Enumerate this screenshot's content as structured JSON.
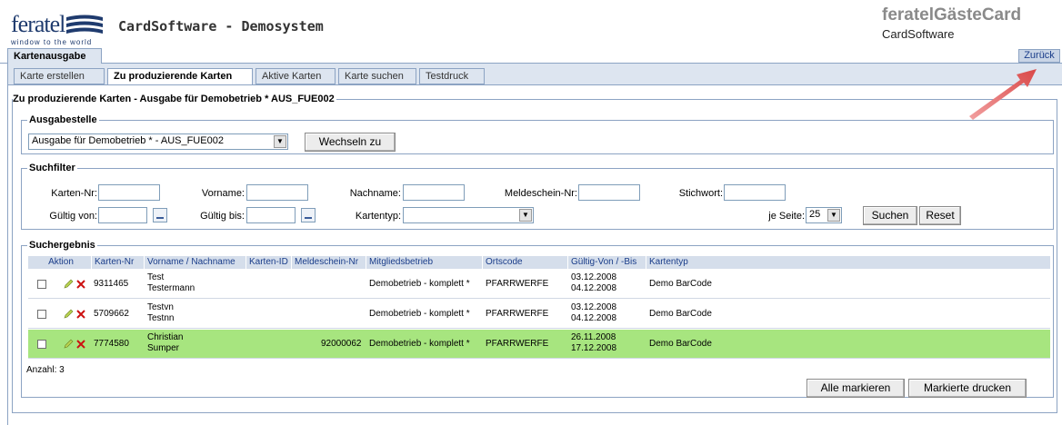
{
  "header": {
    "logo_word": "feratel",
    "logo_tagline": "window to the world",
    "app_title": "CardSoftware - Demosystem",
    "brand_title": "feratelGästeCard",
    "brand_subtitle": "CardSoftware"
  },
  "topnav": {
    "main_tab": "Kartenausgabe",
    "back_label": "Zurück"
  },
  "subtabs": [
    {
      "label": "Karte erstellen",
      "active": false
    },
    {
      "label": "Zu produzierende Karten",
      "active": true
    },
    {
      "label": "Aktive Karten",
      "active": false
    },
    {
      "label": "Karte suchen",
      "active": false
    },
    {
      "label": "Testdruck",
      "active": false
    }
  ],
  "section_title": "Zu produzierende Karten - Ausgabe für Demobetrieb * AUS_FUE002",
  "ausgabestelle": {
    "legend": "Ausgabestelle",
    "select_value": "Ausgabe für Demobetrieb * - AUS_FUE002",
    "switch_label": "Wechseln zu"
  },
  "suchfilter": {
    "legend": "Suchfilter",
    "labels": {
      "karten_nr": "Karten-Nr:",
      "vorname": "Vorname:",
      "nachname": "Nachname:",
      "meldeschein_nr": "Meldeschein-Nr:",
      "stichwort": "Stichwort:",
      "gueltig_von": "Gültig von:",
      "gueltig_bis": "Gültig bis:",
      "kartentyp": "Kartentyp:",
      "je_seite": "je Seite:"
    },
    "je_seite_value": "25",
    "search_label": "Suchen",
    "reset_label": "Reset"
  },
  "results": {
    "legend": "Suchergebnis",
    "columns": [
      "Aktion",
      "Karten-Nr",
      "Vorname / Nachname",
      "Karten-ID",
      "Meldeschein-Nr",
      "Mitgliedsbetrieb",
      "Ortscode",
      "Gültig-Von / -Bis",
      "Kartentyp"
    ],
    "rows": [
      {
        "karten_nr": "9311465",
        "vorname": "Test",
        "nachname": "Testermann",
        "karten_id": "",
        "meldeschein": "",
        "betrieb": "Demobetrieb - komplett *",
        "ortscode": "PFARRWERFE",
        "von": "03.12.2008",
        "bis": "04.12.2008",
        "kartentyp": "Demo BarCode",
        "highlighted": false
      },
      {
        "karten_nr": "5709662",
        "vorname": "Testvn",
        "nachname": "Testnn",
        "karten_id": "",
        "meldeschein": "",
        "betrieb": "Demobetrieb - komplett *",
        "ortscode": "PFARRWERFE",
        "von": "03.12.2008",
        "bis": "04.12.2008",
        "kartentyp": "Demo BarCode",
        "highlighted": false
      },
      {
        "karten_nr": "7774580",
        "vorname": "Christian",
        "nachname": "Sumper",
        "karten_id": "",
        "meldeschein": "92000062",
        "betrieb": "Demobetrieb - komplett *",
        "ortscode": "PFARRWERFE",
        "von": "26.11.2008",
        "bis": "17.12.2008",
        "kartentyp": "Demo BarCode",
        "highlighted": true
      }
    ],
    "count_label": "Anzahl: 3",
    "mark_all_label": "Alle markieren",
    "print_marked_label": "Markierte drucken"
  },
  "colors": {
    "accent": "#1f3b6e",
    "highlight_row": "#a7e57f",
    "panel_bg": "#dde5f0",
    "annotation_arrow": "#e06060"
  }
}
